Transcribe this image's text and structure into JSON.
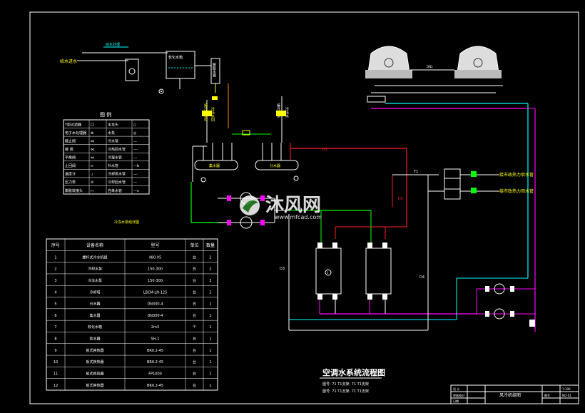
{
  "drawing": {
    "title": "空调水系统流程图",
    "scale_line_1": "图号: 71 T1支架: 71 T1支架",
    "scale_line_2": "图号: 71 T1支架: 71 T1支架",
    "title_block_name": "风冷机组图",
    "title_block_cells": [
      "设 计",
      "审核校对",
      "日期",
      "1:100",
      "图号",
      "NO-01"
    ]
  },
  "watermark": {
    "brand": "沐风网",
    "url": "www.mfcad.com"
  },
  "legend": {
    "title": "图 例",
    "rows": [
      [
        "Y型过滤器",
        "口",
        "水龙头",
        "○"
      ],
      [
        "电子水处理器",
        "⊗",
        "水泵",
        "◎"
      ],
      [
        "截止阀",
        "⋈",
        "冷水管",
        "—"
      ],
      [
        "蝶 阀",
        "⋈",
        "冷热回水管",
        "—·"
      ],
      [
        "平衡阀",
        "⋈",
        "冷凝水管",
        "---"
      ],
      [
        "止回阀",
        "⊳",
        "补水管",
        "—b"
      ],
      [
        "温度计",
        "⊥",
        "冷却供水管",
        "—·"
      ],
      [
        "压力表",
        "⊘",
        "冷却回水管",
        "—"
      ],
      [
        "膨胀软接头",
        "⊓",
        "自来水管",
        "—s"
      ]
    ]
  },
  "equipment_table": {
    "headers": [
      "序号",
      "设备名称",
      "型号",
      "单位",
      "数量"
    ],
    "rows": [
      [
        "1",
        "螺杆式冷水机组",
        "480.V5",
        "台",
        "2"
      ],
      [
        "2",
        "冷却水泵",
        "150-300",
        "台",
        "2"
      ],
      [
        "3",
        "冷冻水泵",
        "150-300",
        "台",
        "2"
      ],
      [
        "4",
        "冷却塔",
        "LBCM-LN-125",
        "台",
        "2"
      ],
      [
        "5",
        "分水器",
        "DN300-4",
        "台",
        "1"
      ],
      [
        "6",
        "集水器",
        "DN300-4",
        "台",
        "1"
      ],
      [
        "7",
        "软化水箱",
        "2m3",
        "个",
        "1"
      ],
      [
        "8",
        "软水器",
        "SH-1",
        "台",
        "1"
      ],
      [
        "9",
        "板式换热器",
        "BR0.2-45",
        "台",
        "1"
      ],
      [
        "10",
        "板式换热器",
        "BR0.2-45",
        "台",
        "1"
      ],
      [
        "11",
        "板式换热器",
        "FP1000",
        "台",
        "1"
      ],
      [
        "12",
        "板式换热器",
        "BR0.2-45",
        "台",
        "1"
      ]
    ]
  },
  "labels": {
    "water_supply": "给水进水",
    "softener_label": "给水处理",
    "soft_tank": "软化水箱",
    "makeup_tank": "膨胀水箱",
    "collector": "集水器",
    "distributor": "分水器",
    "pump_group_caption": "冷冻水泵组详图",
    "to_city_supply": "接市政热力供水管",
    "to_city_return": "接市政热力回水管",
    "pipe_tag_1": "D1",
    "pipe_tag_2": "D2",
    "pipe_tag_3": "T1",
    "pipe_tag_4": "D3",
    "pipe_tag_5": "D4",
    "tower_pipe": "DN1"
  },
  "colors": {
    "background": "#000000",
    "frame": "#ffffff",
    "supply_red": "#ff2020",
    "return_magenta": "#ff00ff",
    "chilled_green": "#00ff00",
    "cyan": "#00ffff",
    "yellow": "#ffff00",
    "white": "#ffffff"
  }
}
